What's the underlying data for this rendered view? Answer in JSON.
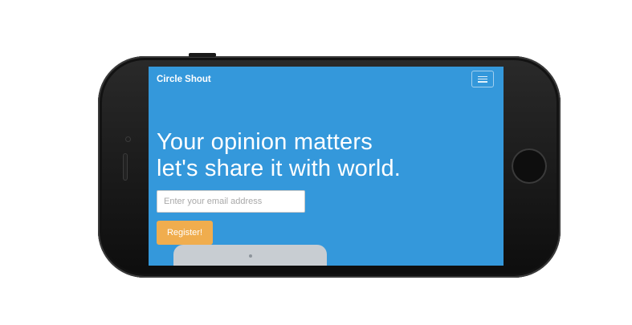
{
  "app": {
    "brand": "Circle Shout"
  },
  "hero": {
    "headline_line1": "Your opinion matters",
    "headline_line2": "let's share it with world."
  },
  "signup": {
    "email_placeholder": "Enter your email address",
    "email_value": "",
    "register_label": "Register!"
  },
  "icons": {
    "menu": "hamburger-menu-icon"
  },
  "colors": {
    "screen_background": "#3498db",
    "register_button": "#f0ad4e",
    "phone_body": "#111111"
  }
}
